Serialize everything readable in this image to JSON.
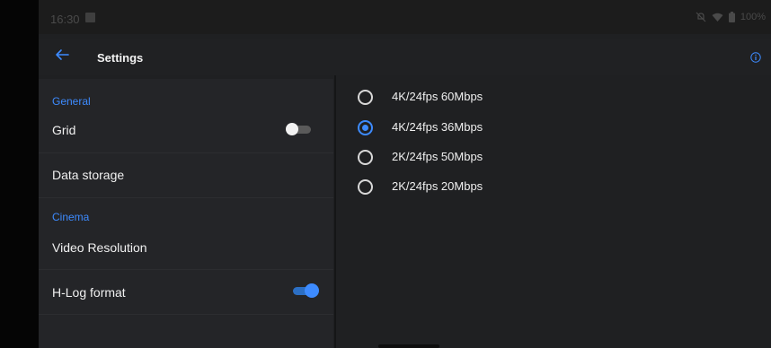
{
  "status_bar": {
    "time": "16:30",
    "battery": "100%",
    "icons": [
      "image-icon",
      "mute-icon",
      "wifi-icon",
      "battery-icon"
    ]
  },
  "header": {
    "title": "Settings",
    "back_icon": "arrow-left-icon",
    "info_icon": "info-icon"
  },
  "sidebar": {
    "sections": [
      {
        "label": "General"
      },
      {
        "label": "Cinema"
      }
    ],
    "items": [
      {
        "label": "Grid",
        "toggle": false
      },
      {
        "label": "Data storage"
      },
      {
        "label": "Video Resolution"
      },
      {
        "label": "H-Log format",
        "toggle": true
      }
    ]
  },
  "resolution_options": {
    "selected_index": 1,
    "items": [
      {
        "label": "4K/24fps 60Mbps"
      },
      {
        "label": "4K/24fps 36Mbps"
      },
      {
        "label": "2K/24fps 50Mbps"
      },
      {
        "label": "2K/24fps 20Mbps"
      }
    ]
  },
  "colors": {
    "accent": "#3d8bff",
    "background": "#1f2022",
    "panel": "#242528"
  }
}
